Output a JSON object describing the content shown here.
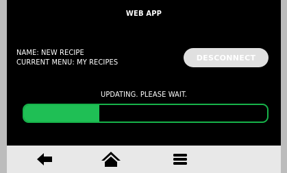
{
  "app": {
    "title": "WEB APP"
  },
  "info": {
    "name_line": "NAME: NEW RECIPE",
    "menu_line": "CURRENT MENU: MY RECIPES"
  },
  "actions": {
    "disconnect_label": "DESCONNECT"
  },
  "status": {
    "message": "UPDATING. PLEASE WAIT."
  },
  "progress": {
    "fraction": 0.31
  },
  "navbar": {
    "items": [
      {
        "icon": "arrow-left-icon"
      },
      {
        "icon": "home-icon"
      },
      {
        "icon": "menu-icon"
      }
    ]
  },
  "colors": {
    "accent": "#1fbf55",
    "screen_bg": "#000000",
    "button_disabled": "#e0e0e0",
    "navbar_bg": "#e8e8e8"
  }
}
